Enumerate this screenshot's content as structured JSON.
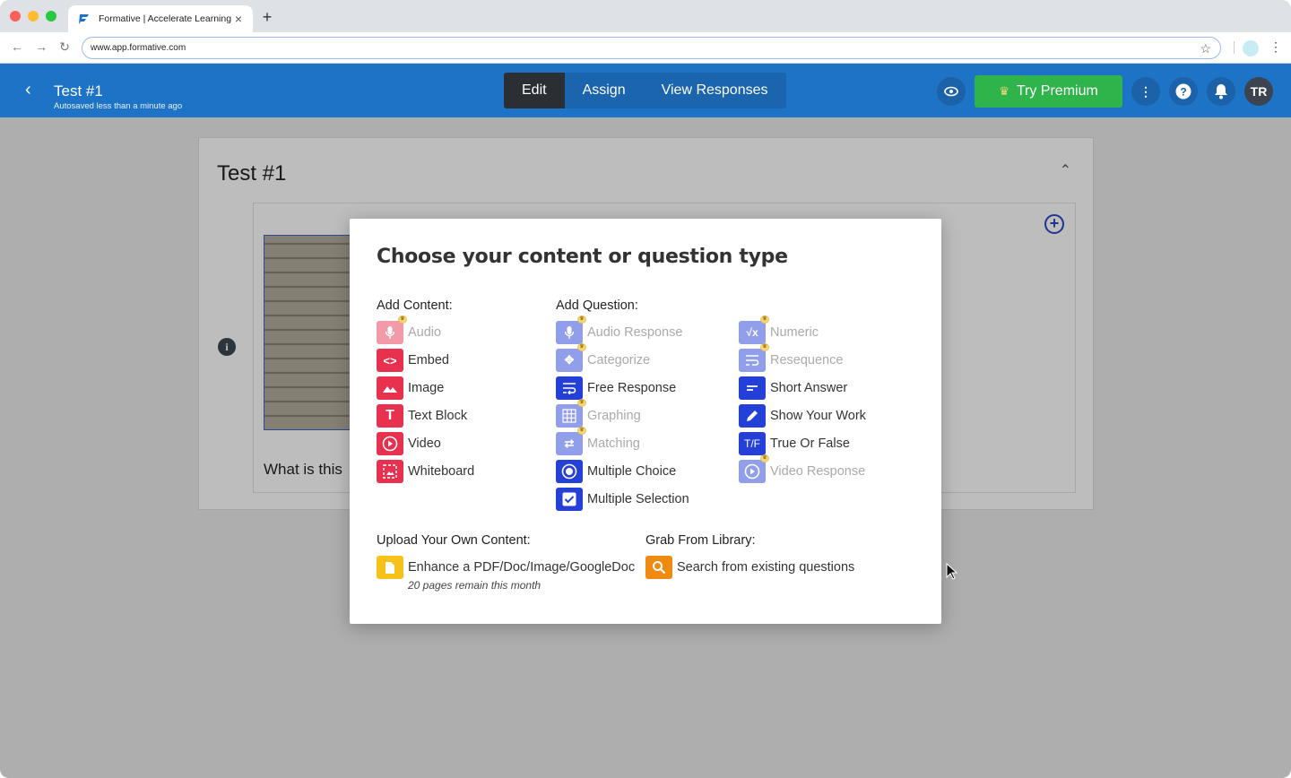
{
  "browser": {
    "tab_title": "Formative | Accelerate Learning",
    "tab_close": "×",
    "new_tab": "+",
    "url": "www.app.formative.com"
  },
  "header": {
    "title": "Test #1",
    "subtitle": "Autosaved less than a minute ago",
    "tabs": [
      "Edit",
      "Assign",
      "View Responses"
    ],
    "premium_label": "Try Premium",
    "avatar": "TR"
  },
  "card": {
    "title": "Test #1",
    "question_text": "What is this"
  },
  "modal": {
    "title": "Choose your content or question type",
    "add_content_label": "Add Content:",
    "add_question_label": "Add Question:",
    "content_items": [
      {
        "label": "Audio",
        "premium": true
      },
      {
        "label": "Embed",
        "premium": false
      },
      {
        "label": "Image",
        "premium": false
      },
      {
        "label": "Text Block",
        "premium": false
      },
      {
        "label": "Video",
        "premium": false
      },
      {
        "label": "Whiteboard",
        "premium": false
      }
    ],
    "question_items_col1": [
      {
        "label": "Audio Response",
        "premium": true
      },
      {
        "label": "Categorize",
        "premium": true
      },
      {
        "label": "Free Response",
        "premium": false
      },
      {
        "label": "Graphing",
        "premium": true
      },
      {
        "label": "Matching",
        "premium": true
      },
      {
        "label": "Multiple Choice",
        "premium": false
      },
      {
        "label": "Multiple Selection",
        "premium": false
      }
    ],
    "question_items_col2": [
      {
        "label": "Numeric",
        "premium": true
      },
      {
        "label": "Resequence",
        "premium": true
      },
      {
        "label": "Short Answer",
        "premium": false
      },
      {
        "label": "Show Your Work",
        "premium": false
      },
      {
        "label": "True Or False",
        "premium": false,
        "icon_text": "T/F"
      },
      {
        "label": "Video Response",
        "premium": true
      }
    ],
    "upload_label": "Upload Your Own Content:",
    "upload_item": "Enhance a PDF/Doc/Image/GoogleDoc",
    "upload_note": "20 pages remain this month",
    "library_label": "Grab From Library:",
    "library_item": "Search from existing questions"
  },
  "colors": {
    "header_blue": "#1d73c5",
    "premium_green": "#2fb34b",
    "content_red": "#e8304f",
    "question_blue": "#2540d6"
  }
}
